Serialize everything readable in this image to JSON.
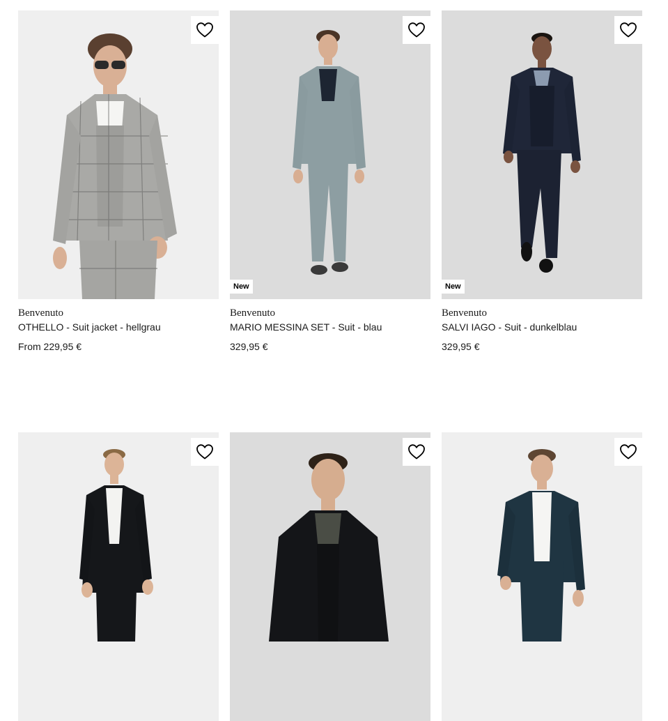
{
  "colors": {
    "page_background": "#ffffff",
    "image_background": "#e8e8e8",
    "text": "#1a1a1a"
  },
  "products": [
    {
      "brand": "Benvenuto",
      "name": "OTHELLO - Suit jacket - hellgrau",
      "price": "From 229,95 €",
      "badge": "",
      "wishlist_icon": "heart-outline-icon"
    },
    {
      "brand": "Benvenuto",
      "name": "MARIO MESSINA SET - Suit - blau",
      "price": "329,95 €",
      "badge": "New",
      "wishlist_icon": "heart-outline-icon"
    },
    {
      "brand": "Benvenuto",
      "name": "SALVI IAGO - Suit - dunkelblau",
      "price": "329,95 €",
      "badge": "New",
      "wishlist_icon": "heart-outline-icon"
    },
    {
      "brand": "",
      "name": "",
      "price": "",
      "badge": "",
      "wishlist_icon": "heart-outline-icon"
    },
    {
      "brand": "",
      "name": "",
      "price": "",
      "badge": "",
      "wishlist_icon": "heart-outline-icon"
    },
    {
      "brand": "",
      "name": "",
      "price": "",
      "badge": "",
      "wishlist_icon": "heart-outline-icon"
    }
  ]
}
